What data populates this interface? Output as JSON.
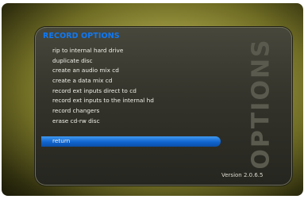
{
  "panel": {
    "title": "RECORD OPTIONS",
    "side_label": "OPTIONS",
    "version": "Version 2.0.6.5"
  },
  "menu": {
    "selected_index": 9,
    "items": [
      {
        "label": "rip to internal hard drive"
      },
      {
        "label": "duplicate disc"
      },
      {
        "label": "create an audio mix cd"
      },
      {
        "label": "create a data mix cd"
      },
      {
        "label": "record ext inputs direct to cd"
      },
      {
        "label": "record ext inputs to the internal hd"
      },
      {
        "label": "record changers"
      },
      {
        "label": "erase cd-rw disc"
      },
      {
        "label": ""
      },
      {
        "label": "return"
      }
    ]
  },
  "colors": {
    "title_color": "#0f79f4",
    "highlight": "#1164cf",
    "background_gradient": "#a8a44a"
  }
}
